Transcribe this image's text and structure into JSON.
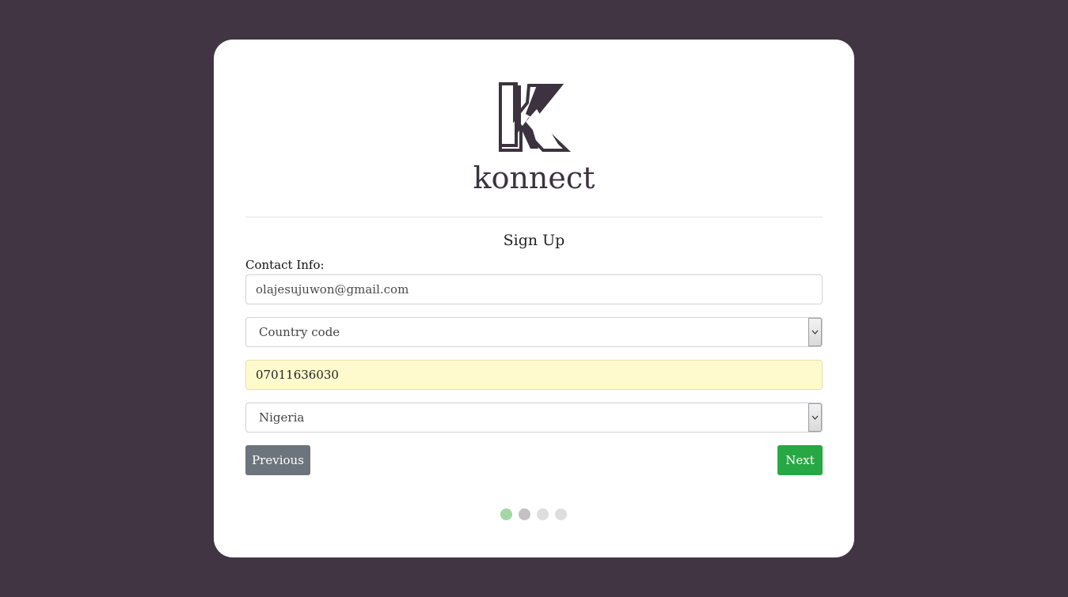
{
  "brand": {
    "logo_icon": "konnect-k-logo-icon",
    "name": "konnect"
  },
  "form": {
    "title": "Sign Up",
    "section_label": "Contact Info:",
    "email_value": "olajesujuwon@gmail.com",
    "country_code_select": {
      "selected": "Country code"
    },
    "phone_value": "07011636030",
    "country_select": {
      "selected": "Nigeria"
    },
    "previous_label": "Previous",
    "next_label": "Next"
  },
  "steps": {
    "total": 4,
    "current": 1,
    "colors": [
      "#a3d7a5",
      "#c2c2c2",
      "#dedede",
      "#dedede"
    ]
  },
  "colors": {
    "background": "#413543",
    "card": "#ffffff",
    "next_button": "#28a745",
    "previous_button": "#6c757d",
    "autofill": "#fffacd"
  }
}
